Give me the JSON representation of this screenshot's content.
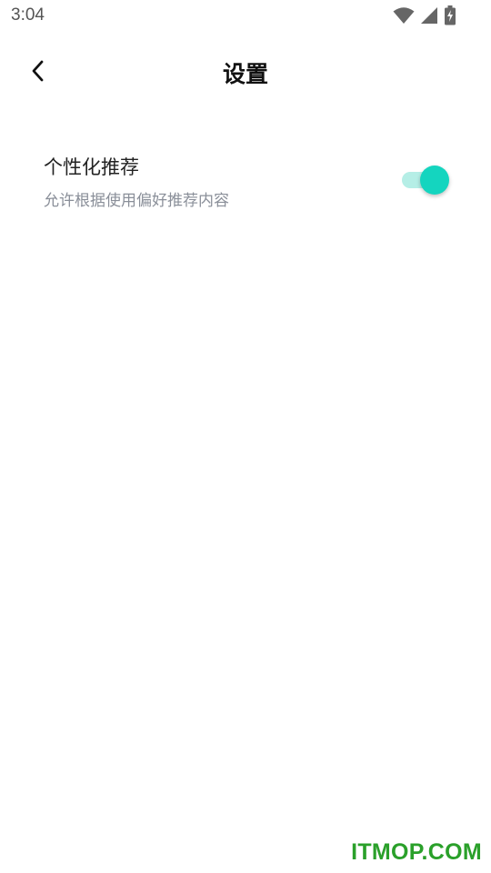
{
  "status_bar": {
    "time": "3:04",
    "icons": [
      "wifi-icon",
      "cell-signal-icon",
      "battery-charging-icon"
    ]
  },
  "header": {
    "back_icon": "chevron-left-icon",
    "title": "设置"
  },
  "settings": [
    {
      "title": "个性化推荐",
      "description": "允许根据使用偏好推荐内容",
      "enabled": true
    }
  ],
  "colors": {
    "toggle_on_thumb": "#14d5bf",
    "toggle_on_track": "#b5eee6",
    "watermark": "#2aa02a"
  },
  "watermark": {
    "text": "ITMOP.COM"
  }
}
